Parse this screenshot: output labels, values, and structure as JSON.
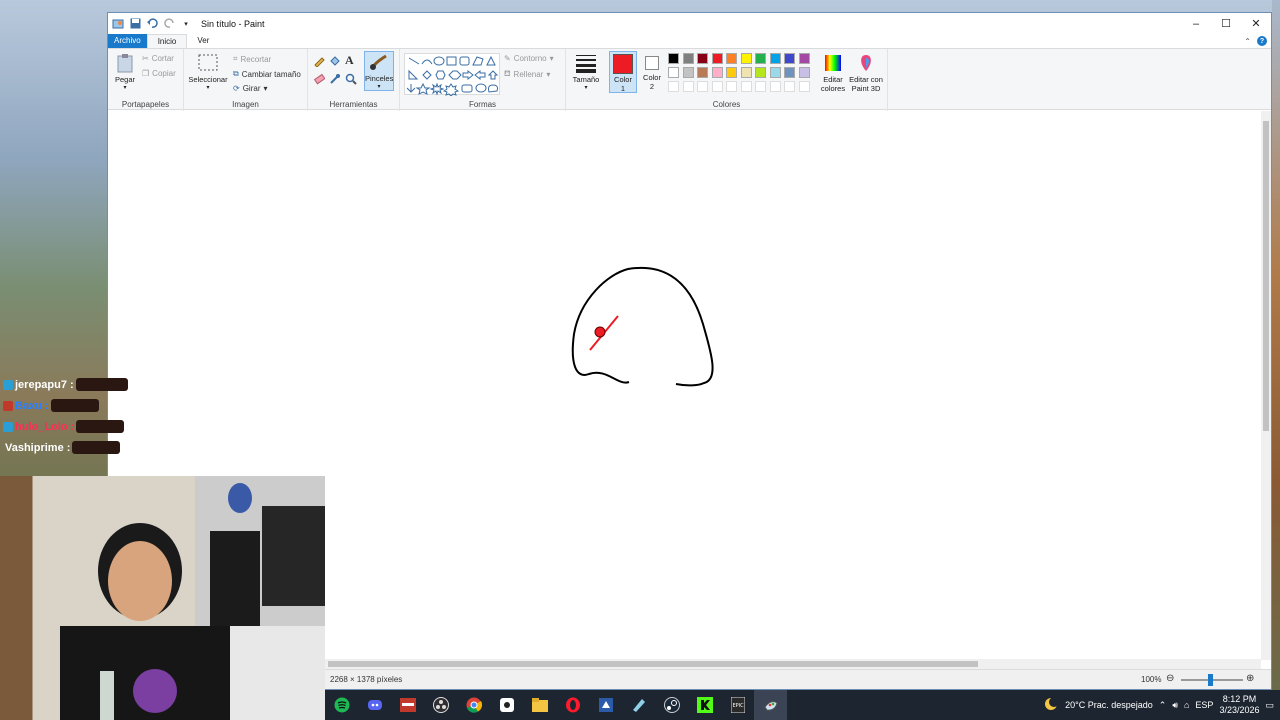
{
  "window": {
    "title": "Sin título - Paint",
    "controls": {
      "minimize": "–",
      "maximize": "☐",
      "close": "✕"
    }
  },
  "menu": {
    "file": "Archivo",
    "tabs": [
      "Inicio",
      "Ver"
    ]
  },
  "ribbon": {
    "clipboard": {
      "paste": "Pegar",
      "cut": "Cortar",
      "copy": "Copiar",
      "label": "Portapapeles"
    },
    "image": {
      "select": "Seleccionar",
      "crop": "Recortar",
      "resize": "Cambiar tamaño",
      "rotate": "Girar",
      "label": "Imagen"
    },
    "tools": {
      "brushes": "Pinceles",
      "label": "Herramientas"
    },
    "shapes": {
      "outline": "Contorno",
      "fill": "Rellenar",
      "label": "Formas"
    },
    "size": "Tamaño",
    "color1": {
      "line1": "Color",
      "line2": "1"
    },
    "color2": {
      "line1": "Color",
      "line2": "2"
    },
    "edit_colors": {
      "line1": "Editar",
      "line2": "colores"
    },
    "paint3d": {
      "line1": "Editar con",
      "line2": "Paint 3D"
    },
    "colors_label": "Colores",
    "accent": "#1979ca",
    "color1_value": "#ed1c24",
    "color2_value": "#ffffff",
    "palette_row1": [
      "#000000",
      "#7f7f7f",
      "#880015",
      "#ed1c24",
      "#ff7f27",
      "#fff200",
      "#22b14c",
      "#00a2e8",
      "#3f48cc",
      "#a349a4"
    ],
    "palette_row2": [
      "#ffffff",
      "#c3c3c3",
      "#b97a57",
      "#ffaec9",
      "#ffc90e",
      "#efe4b0",
      "#b5e61d",
      "#99d9ea",
      "#7092be",
      "#c8bfe7"
    ]
  },
  "status": {
    "dimensions": "2268 × 1378 píxeles",
    "zoom": "100%"
  },
  "chat": [
    {
      "user": "jerepapu7 :",
      "color": "#ffffff"
    },
    {
      "user": "Baxu :",
      "color": "#2a7fff"
    },
    {
      "user": "hulo_Lolo :",
      "color": "#ff2d55"
    },
    {
      "user": "Vashiprime :",
      "color": "#ffffff"
    }
  ],
  "taskbar": {
    "weather": "20°C  Prac. despejado",
    "language": "ESP",
    "time": "8:12 PM",
    "date": "3/23/2026"
  }
}
